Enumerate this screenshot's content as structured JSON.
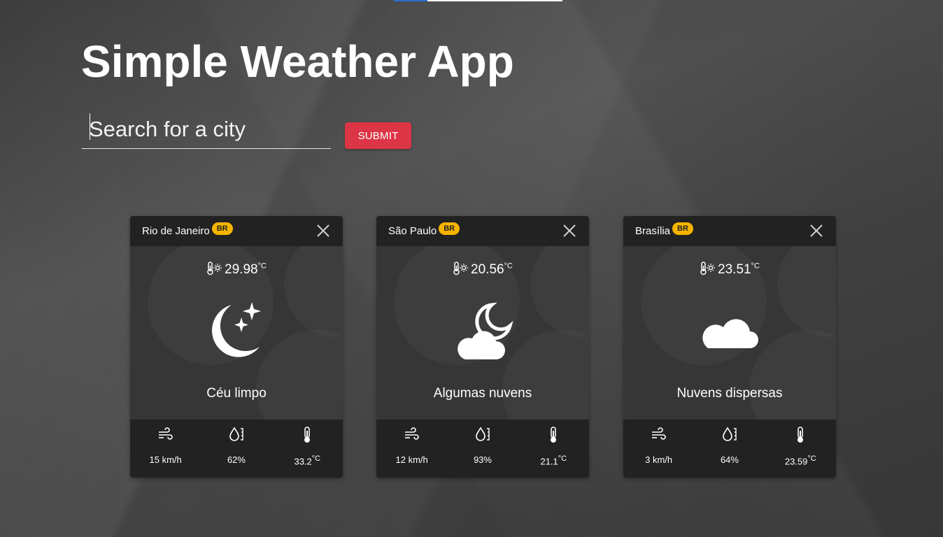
{
  "app": {
    "title": "Simple Weather App",
    "search_placeholder": "Search for a city",
    "submit_label": "SUBMIT"
  },
  "colors": {
    "submit": "#dc3545",
    "badge": "#f5b400",
    "card_header": "#222222",
    "card_body": "#363636"
  },
  "cards": [
    {
      "city": "Rio de Janeiro",
      "country": "BR",
      "temp": "29.98",
      "temp_unit": "°C",
      "icon": "moon-stars-icon",
      "description": "Céu limpo",
      "wind": "15 km/h",
      "humidity": "62%",
      "feels_like": "33.2",
      "feels_unit": "°C"
    },
    {
      "city": "São Paulo",
      "country": "BR",
      "temp": "20.56",
      "temp_unit": "°C",
      "icon": "cloud-moon-icon",
      "description": "Algumas nuvens",
      "wind": "12 km/h",
      "humidity": "93%",
      "feels_like": "21.1",
      "feels_unit": "°C"
    },
    {
      "city": "Brasília",
      "country": "BR",
      "temp": "23.51",
      "temp_unit": "°C",
      "icon": "cloud-icon",
      "description": "Nuvens dispersas",
      "wind": "3 km/h",
      "humidity": "64%",
      "feels_like": "23.59",
      "feels_unit": "°C"
    }
  ]
}
